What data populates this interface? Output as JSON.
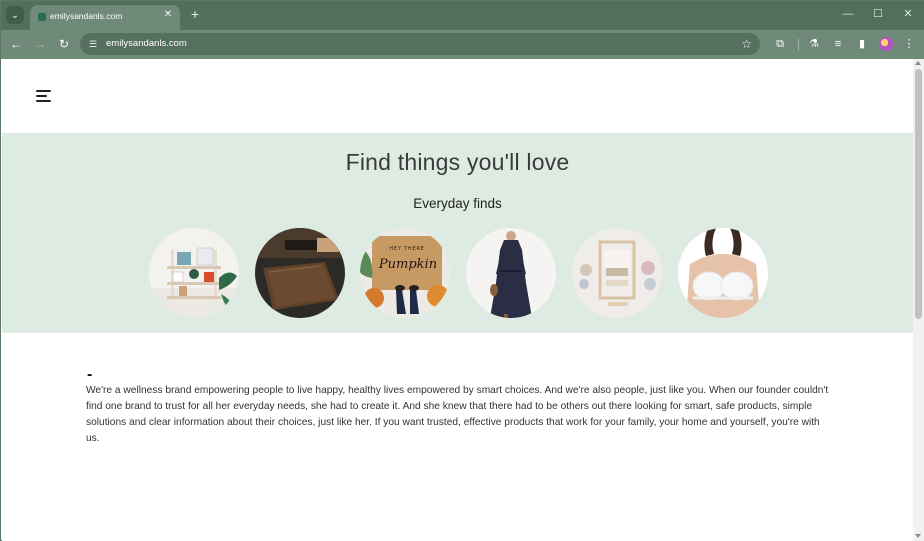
{
  "browser": {
    "tab_title": "emilysandanls.com",
    "url": "emilysandanls.com",
    "icons": {
      "tab_search": "chevron-down-icon",
      "tab_close": "close-icon",
      "new_tab": "plus-icon",
      "back": "arrow-left-icon",
      "forward": "arrow-right-icon",
      "reload": "reload-icon",
      "site_info": "tune-icon",
      "bookmark": "star-icon",
      "extensions": "puzzle-icon",
      "labs": "flask-icon",
      "reading_list": "queue-icon",
      "side_panel": "side-panel-icon",
      "menu": "kebab-menu-icon"
    },
    "colors": {
      "frame": "#50705c",
      "toolbar": "#6f8a79",
      "omnibox": "#56705f"
    }
  },
  "site": {
    "hero": {
      "title": "Find things you'll love",
      "subtitle": "Everyday finds",
      "background": "#deebe2",
      "categories": [
        {
          "name": "home-shelf",
          "image": "shelf-decor"
        },
        {
          "name": "wallet",
          "image": "leather-wallet"
        },
        {
          "name": "doormat",
          "image": "hey-there-pumpkin-doormat"
        },
        {
          "name": "dress",
          "image": "navy-dress"
        },
        {
          "name": "craft-kit",
          "image": "weaving-loom"
        },
        {
          "name": "lingerie",
          "image": "white-lace-bra"
        }
      ]
    },
    "about": {
      "dash": "-",
      "text": "We're a wellness brand empowering people to live happy, healthy lives empowered by smart choices. And we're also people, just like you. When our founder couldn't find one brand to trust for all her everyday needs, she had to create it. And she knew that there had to be others out there looking for smart, safe products, simple solutions and clear information about their choices, just like her. If you want trusted, effective products that work for your family, your home and yourself, you're with us."
    },
    "doormat_text": {
      "line1": "HEY THERE",
      "line2": "Pumpkin"
    }
  }
}
